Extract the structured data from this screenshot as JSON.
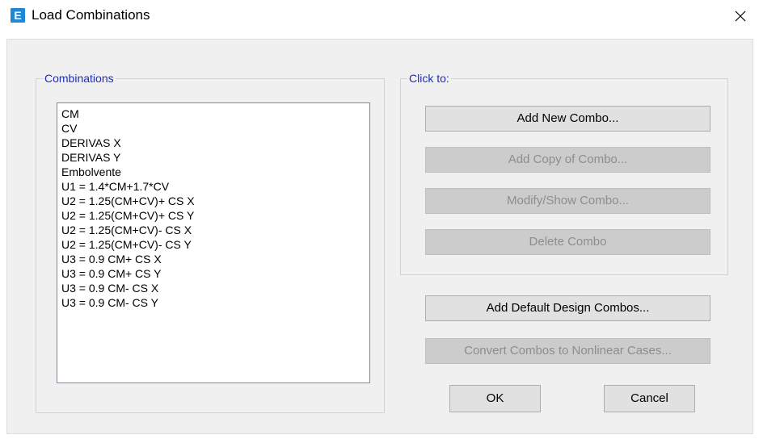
{
  "window": {
    "title": "Load Combinations",
    "icon_letter": "E",
    "icon_color": "#1e88d6"
  },
  "combinations_group": {
    "label": "Combinations",
    "items": [
      "CM",
      "CV",
      "DERIVAS X",
      "DERIVAS Y",
      "Embolvente",
      "U1 = 1.4*CM+1.7*CV",
      "U2 = 1.25(CM+CV)+ CS X",
      "U2 = 1.25(CM+CV)+ CS Y",
      "U2 = 1.25(CM+CV)- CS X",
      "U2 = 1.25(CM+CV)- CS Y",
      "U3 = 0.9 CM+ CS X",
      "U3 = 0.9 CM+ CS Y",
      "U3 = 0.9 CM- CS X",
      "U3 = 0.9 CM- CS Y"
    ]
  },
  "click_to_group": {
    "label": "Click to:",
    "add_new": "Add New Combo...",
    "add_copy": "Add Copy of Combo...",
    "modify_show": "Modify/Show Combo...",
    "delete": "Delete Combo"
  },
  "actions": {
    "add_default": "Add Default Design Combos...",
    "convert": "Convert Combos to Nonlinear Cases...",
    "ok": "OK",
    "cancel": "Cancel"
  },
  "colors": {
    "group_label": "#1b2dbe",
    "dialog_bg": "#f0f0f0",
    "button_bg": "#e1e1e1",
    "button_disabled_bg": "#cccccc",
    "disabled_text": "#8d8d8d"
  }
}
